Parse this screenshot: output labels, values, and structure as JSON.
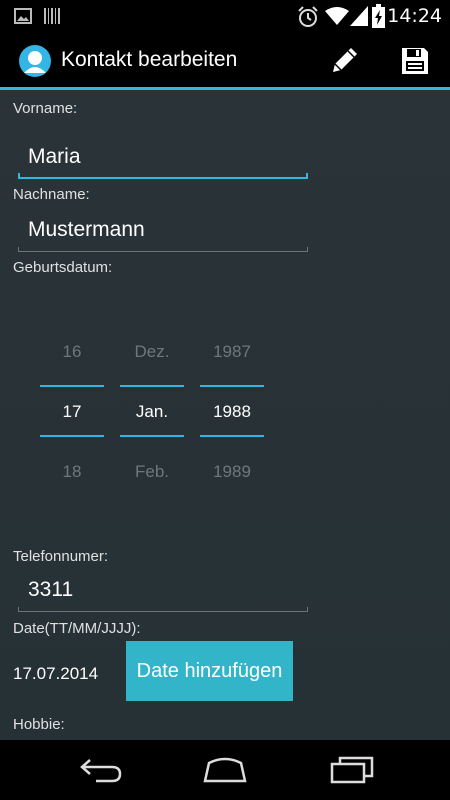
{
  "status_bar": {
    "time": "14:24"
  },
  "action_bar": {
    "title": "Kontakt bearbeiten"
  },
  "form": {
    "first_name_label": "Vorname:",
    "first_name_value": "Maria",
    "last_name_label": "Nachname:",
    "last_name_value": "Mustermann",
    "birthdate_label": "Geburtsdatum:",
    "phone_label": "Telefonnumer:",
    "phone_value": "3311",
    "date_label": "Date(TT/MM/JJJJ):",
    "date_value": "17.07.2014",
    "add_date_button": "Date hinzufügen",
    "hobby_label": "Hobbie:"
  },
  "date_picker": {
    "day": {
      "prev": "16",
      "current": "17",
      "next": "18"
    },
    "month": {
      "prev": "Dez.",
      "current": "Jan.",
      "next": "Feb."
    },
    "year": {
      "prev": "1987",
      "current": "1988",
      "next": "1989"
    }
  },
  "colors": {
    "accent": "#33b5e5",
    "button": "#33b5c9",
    "background": "#263238"
  }
}
